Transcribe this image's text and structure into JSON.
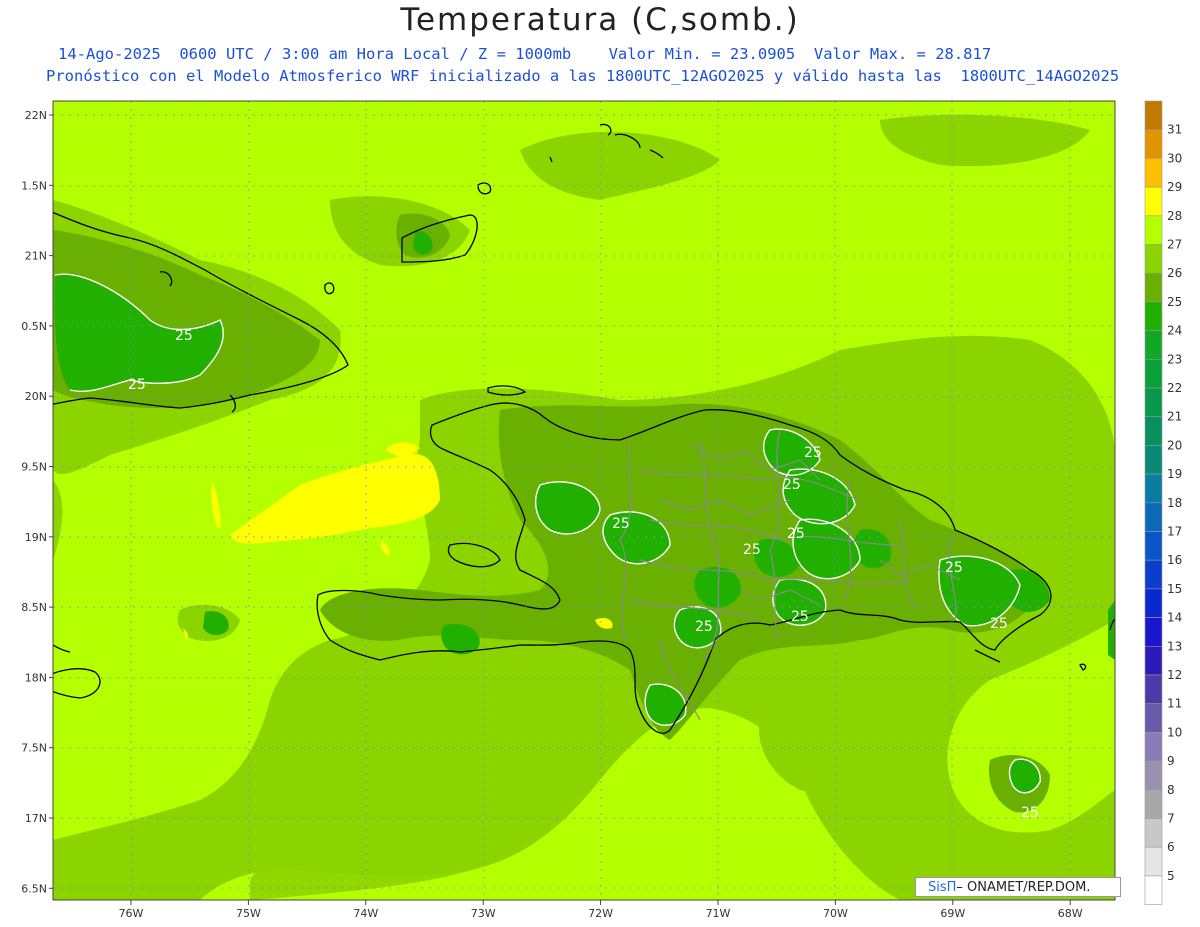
{
  "title": "Temperatura (C,somb.)",
  "subtitle_line1": "14-Ago-2025  0600 UTC / 3:00 am Hora Local / Z = 1000mb    Valor Min. = 23.0905  Valor Max. = 28.817",
  "subtitle_line2": "Pronóstico con el Modelo Atmosferico WRF inicializado a las 1800UTC_12AGO2025 y válido hasta las  1800UTC_14AGO2025",
  "credit": {
    "brand": "SisΠ",
    "text": " – ONAMET/REP.DOM."
  },
  "contour_labels": [
    "25",
    "25",
    "25",
    "25",
    "25",
    "25",
    "25",
    "25",
    "25",
    "25"
  ],
  "lat_labels": [
    "22N",
    "1.5N",
    "21N",
    "0.5N",
    "20N",
    "9.5N",
    "19N",
    "8.5N",
    "18N",
    "7.5N",
    "17N",
    "6.5N"
  ],
  "lon_labels": [
    "76W",
    "75W",
    "74W",
    "73W",
    "72W",
    "71W",
    "70W",
    "69W",
    "68W"
  ],
  "colorbar": [
    {
      "value": "31",
      "color": "#c07a00"
    },
    {
      "value": "30",
      "color": "#e09500"
    },
    {
      "value": "29",
      "color": "#ffc000"
    },
    {
      "value": "28",
      "color": "#ffff00"
    },
    {
      "value": "27",
      "color": "#b4ff00"
    },
    {
      "value": "26",
      "color": "#8cd400"
    },
    {
      "value": "25",
      "color": "#6ab000"
    },
    {
      "value": "24",
      "color": "#22b000"
    },
    {
      "value": "23",
      "color": "#10a826"
    },
    {
      "value": "22",
      "color": "#08a038"
    },
    {
      "value": "21",
      "color": "#08984a"
    },
    {
      "value": "20",
      "color": "#0a905e"
    },
    {
      "value": "19",
      "color": "#0a8a74"
    },
    {
      "value": "18",
      "color": "#0a7ea0"
    },
    {
      "value": "17",
      "color": "#0a6ab8"
    },
    {
      "value": "16",
      "color": "#0a55c8"
    },
    {
      "value": "15",
      "color": "#0a3ecc"
    },
    {
      "value": "14",
      "color": "#0a28d0"
    },
    {
      "value": "13",
      "color": "#1a16cc"
    },
    {
      "value": "12",
      "color": "#2a1ab8"
    },
    {
      "value": "11",
      "color": "#4a3aaa"
    },
    {
      "value": "10",
      "color": "#6a5aaa"
    },
    {
      "value": "9",
      "color": "#8a7ab8"
    },
    {
      "value": "8",
      "color": "#9a90b0"
    },
    {
      "value": "7",
      "color": "#a8a8a8"
    },
    {
      "value": "6",
      "color": "#c8c8c8"
    },
    {
      "value": "5",
      "color": "#e6e6e6"
    },
    {
      "value": "",
      "color": "#ffffff"
    }
  ],
  "colors": {
    "field_base": "#b4ff00",
    "field_26": "#8cd400",
    "field_25": "#6ab000",
    "field_24": "#22b000",
    "field_28": "#ffff00",
    "coast": "#000000",
    "border": "#8a8a8a",
    "grid": "#7a7aff",
    "contour": "#ffffff"
  }
}
